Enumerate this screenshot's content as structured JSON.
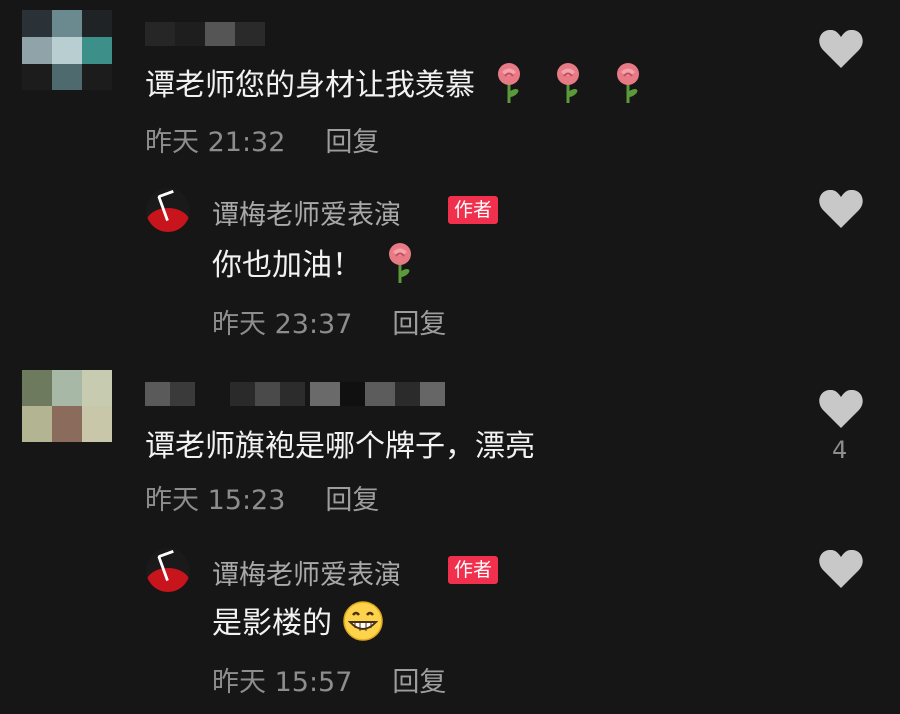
{
  "comments": [
    {
      "text": "谭老师您的身材让我羡慕",
      "emoji": [
        "rose-emoji",
        "rose-emoji",
        "rose-emoji"
      ],
      "time": "昨天 21:32",
      "reply_label": "回复",
      "reply": {
        "author": "谭梅老师爱表演",
        "badge": "作者",
        "text": "你也加油！",
        "emoji": [
          "rose-emoji"
        ],
        "time": "昨天 23:37",
        "reply_label": "回复"
      }
    },
    {
      "text": "谭老师旗袍是哪个牌子，漂亮",
      "time": "昨天 15:23",
      "reply_label": "回复",
      "likes": "4",
      "reply": {
        "author": "谭梅老师爱表演",
        "badge": "作者",
        "text": "是影楼的",
        "emoji": [
          "grinning-face-emoji"
        ],
        "time": "昨天 15:57",
        "reply_label": "回复"
      }
    }
  ],
  "colors": {
    "background": "#161616",
    "badge": "#f0304d",
    "heart": "#c8c8c8"
  }
}
